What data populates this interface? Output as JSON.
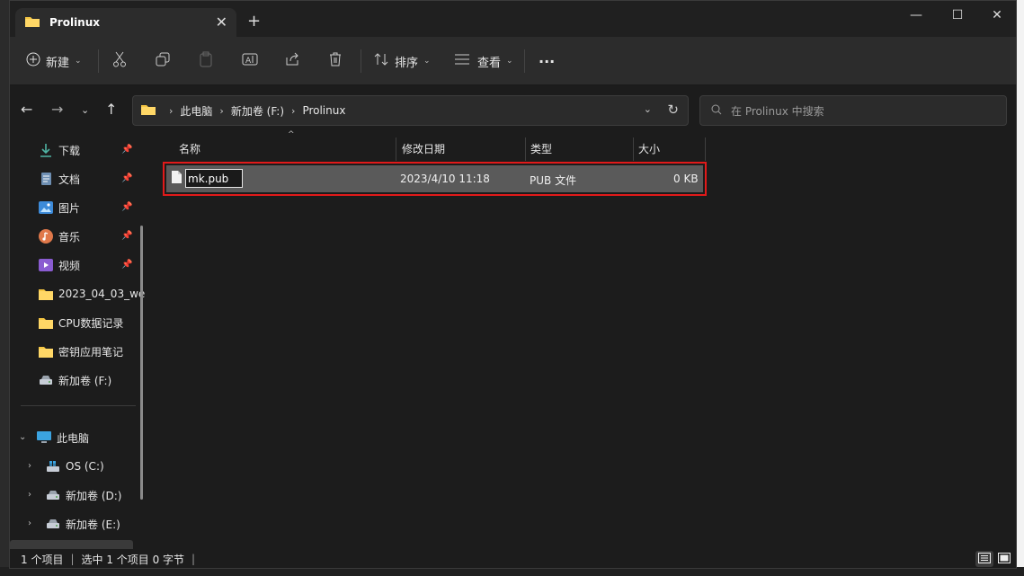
{
  "window": {
    "tab_title": "Prolinux",
    "new_tab": "+",
    "minimize": "—",
    "maximize": "☐",
    "close": "✕"
  },
  "toolbar": {
    "new_label": "新建",
    "sort_label": "排序",
    "view_label": "查看",
    "more": "···"
  },
  "address": {
    "crumbs": [
      "此电脑",
      "新加卷 (F:)",
      "Prolinux"
    ]
  },
  "search": {
    "placeholder": "在 Prolinux 中搜索"
  },
  "sidebar": {
    "quick": [
      {
        "label": "下载",
        "icon": "download-icon",
        "pinned": true
      },
      {
        "label": "文档",
        "icon": "document-icon",
        "pinned": true
      },
      {
        "label": "图片",
        "icon": "picture-icon",
        "pinned": true
      },
      {
        "label": "音乐",
        "icon": "music-icon",
        "pinned": true
      },
      {
        "label": "视频",
        "icon": "video-icon",
        "pinned": true
      },
      {
        "label": "2023_04_03_we",
        "icon": "folder-icon",
        "pinned": false
      },
      {
        "label": "CPU数据记录",
        "icon": "folder-icon",
        "pinned": false
      },
      {
        "label": "密钥应用笔记",
        "icon": "folder-icon",
        "pinned": false
      },
      {
        "label": "新加卷 (F:)",
        "icon": "drive-icon",
        "pinned": false
      }
    ],
    "this_pc": "此电脑",
    "drives": [
      "OS (C:)",
      "新加卷 (D:)",
      "新加卷 (E:)"
    ]
  },
  "list": {
    "columns": [
      "名称",
      "修改日期",
      "类型",
      "大小"
    ],
    "rows": [
      {
        "name": "mk.pub",
        "modified": "2023/4/10 11:18",
        "type": "PUB 文件",
        "size": "0 KB"
      }
    ]
  },
  "status": {
    "count": "1 个项目",
    "selected": "选中 1 个项目  0 字节"
  },
  "colors": {
    "accent_red": "#e11a1a",
    "folder_yellow": "#f4c542",
    "selected_row": "#5a5a5a"
  }
}
